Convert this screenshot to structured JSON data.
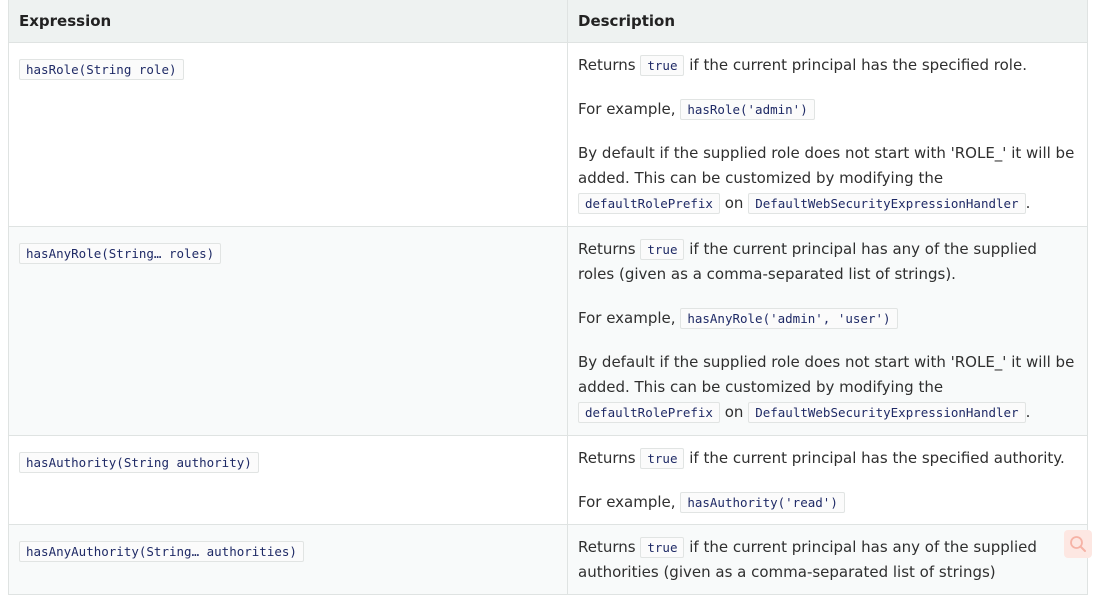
{
  "table": {
    "headers": {
      "expression": "Expression",
      "description": "Description"
    },
    "rows": [
      {
        "expression": "hasRole(String role)",
        "desc1_pre": "Returns",
        "desc1_code": "true",
        "desc1_post": "if the current principal has the specified role.",
        "example_pre": "For example,",
        "example_code": "hasRole('admin')",
        "default_text": "By default if the supplied role does not start with 'ROLE_' it will be added. This can be customized by modifying the",
        "default_code1": "defaultRolePrefix",
        "default_on": "on",
        "default_code2": "DefaultWebSecurityExpressionHandler",
        "default_end": "."
      },
      {
        "expression": "hasAnyRole(String… roles)",
        "desc1_pre": "Returns",
        "desc1_code": "true",
        "desc1_post": "if the current principal has any of the supplied roles (given as a comma-separated list of strings).",
        "example_pre": "For example,",
        "example_code": "hasAnyRole('admin', 'user')",
        "default_text": "By default if the supplied role does not start with 'ROLE_' it will be added. This can be customized by modifying the",
        "default_code1": "defaultRolePrefix",
        "default_on": "on",
        "default_code2": "DefaultWebSecurityExpressionHandler",
        "default_end": "."
      },
      {
        "expression": "hasAuthority(String authority)",
        "desc1_pre": "Returns",
        "desc1_code": "true",
        "desc1_post": "if the current principal has the specified authority.",
        "example_pre": "For example,",
        "example_code": "hasAuthority('read')"
      },
      {
        "expression": "hasAnyAuthority(String… authorities)",
        "desc1_pre": "Returns",
        "desc1_code": "true",
        "desc1_post": "if the current principal has any of the supplied authorities (given as a comma-separated list of strings)"
      }
    ]
  },
  "search_button": {
    "icon": "search-icon",
    "color": "#fde7e2"
  }
}
